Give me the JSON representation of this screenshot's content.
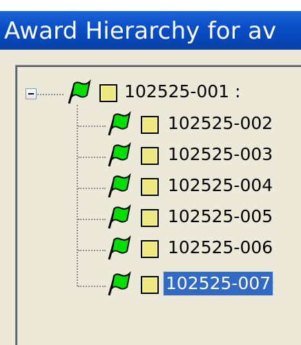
{
  "window": {
    "title": "Award Hierarchy for av"
  },
  "tree": {
    "root": {
      "label": "102525-001 :",
      "expanded": true
    },
    "children": [
      {
        "label": "102525-002",
        "selected": false
      },
      {
        "label": "102525-003",
        "selected": false
      },
      {
        "label": "102525-004",
        "selected": false
      },
      {
        "label": "102525-005",
        "selected": false
      },
      {
        "label": "102525-006",
        "selected": false
      },
      {
        "label": "102525-007",
        "selected": true
      }
    ],
    "icons": {
      "node": "green-flag-icon",
      "folder": "yellow-folder-icon",
      "expander": "minus-expander-icon"
    },
    "colors": {
      "flag": "#00e000",
      "folder": "#f4f08c",
      "selection": "#316ac5",
      "title_bar": "#0a4fc8"
    }
  }
}
